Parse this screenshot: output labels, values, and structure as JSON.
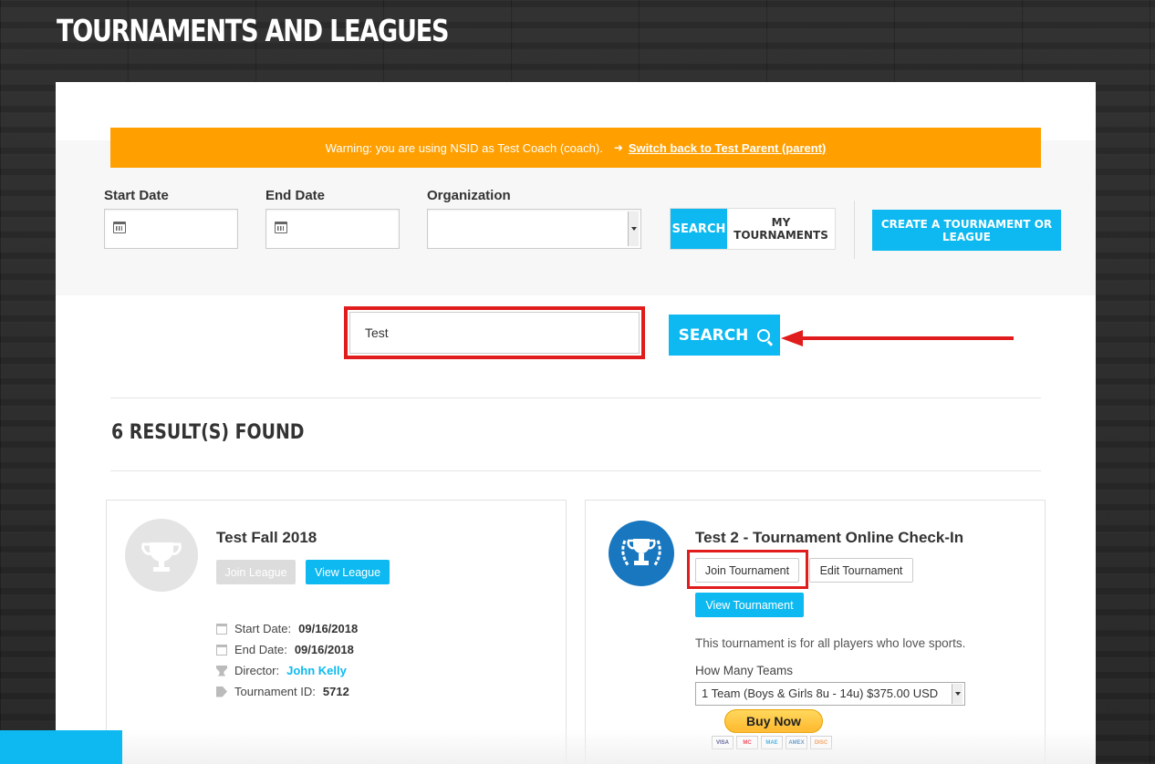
{
  "page": {
    "title": "TOURNAMENTS AND LEAGUES"
  },
  "warning": {
    "text": "Warning: you are using NSID as Test Coach (coach).",
    "switch_icon": "sign-out-icon",
    "switch_link": "Switch back to Test Parent (parent)"
  },
  "filters": {
    "start_date_label": "Start Date",
    "end_date_label": "End Date",
    "organization_label": "Organization",
    "start_date_value": "",
    "end_date_value": "",
    "organization_value": "",
    "search_label": "SEARCH",
    "my_tournaments_label": "MY TOURNAMENTS",
    "create_label": "CREATE A TOURNAMENT OR LEAGUE"
  },
  "search": {
    "value": "Test",
    "button_label": "SEARCH",
    "icon": "search-icon"
  },
  "results_heading": "6 RESULT(S) FOUND",
  "events": [
    {
      "title": "Test Fall 2018",
      "icon": "trophy-icon",
      "join_label": "Join League",
      "view_label": "View League",
      "start_date_label": "Start Date:",
      "start_date": "09/16/2018",
      "end_date_label": "End Date:",
      "end_date": "09/16/2018",
      "director_label": "Director:",
      "director": "John Kelly",
      "id_label": "Tournament ID:",
      "id": "5712"
    },
    {
      "title": "Test 2 - Tournament Online Check-In",
      "icon": "laurel-trophy-icon",
      "join_label": "Join Tournament",
      "edit_label": "Edit Tournament",
      "view_label": "View Tournament",
      "description": "This tournament is for all players who love sports.",
      "teams_label": "How Many Teams",
      "teams_value": "1 Team (Boys & Girls 8u - 14u) $375.00 USD",
      "buy_label": "Buy Now",
      "cards": [
        "VISA",
        "MC",
        "MAE",
        "AMEX",
        "DISC"
      ]
    }
  ],
  "colors": {
    "accent": "#0db9f0",
    "warning": "#ff9f00",
    "highlight": "#e01c1c"
  }
}
